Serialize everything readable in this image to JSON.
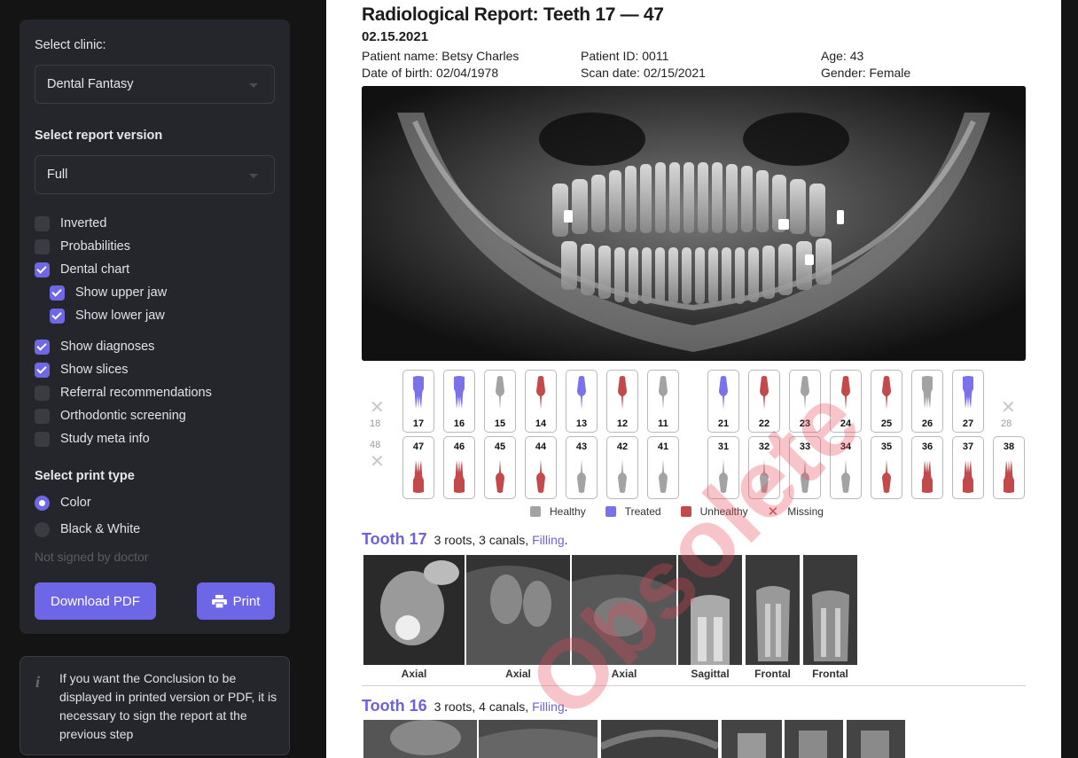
{
  "sidebar": {
    "clinic_label": "Select clinic:",
    "clinic_value": "Dental Fantasy",
    "version_label": "Select report version",
    "version_value": "Full",
    "options": [
      {
        "label": "Inverted",
        "checked": false
      },
      {
        "label": "Probabilities",
        "checked": false
      },
      {
        "label": "Dental chart",
        "checked": true
      },
      {
        "label": "Show upper jaw",
        "checked": true
      },
      {
        "label": "Show lower jaw",
        "checked": true
      },
      {
        "label": "Show diagnoses",
        "checked": true
      },
      {
        "label": "Show slices",
        "checked": true
      },
      {
        "label": "Referral recommendations",
        "checked": false
      },
      {
        "label": "Orthodontic screening",
        "checked": false
      },
      {
        "label": "Study meta info",
        "checked": false
      }
    ],
    "print_type_label": "Select print type",
    "print_types": [
      {
        "label": "Color",
        "selected": true
      },
      {
        "label": "Black & White",
        "selected": false
      }
    ],
    "signed_status": "Not signed by doctor",
    "download_label": "Download PDF",
    "print_label": "Print",
    "info_text": "If you want the Conclusion to be displayed in printed version or PDF, it is necessary to sign the report at the previous step"
  },
  "report": {
    "title": "Radiological Report: Teeth 17 — 47",
    "date": "02.15.2021",
    "patient_name": "Patient name: Betsy Charles",
    "patient_id": "Patient ID: 0011",
    "age": "Age: 43",
    "dob": "Date of birth: 02/04/1978",
    "scan_date": "Scan date: 02/15/2021",
    "gender": "Gender: Female",
    "watermark": "Obsolete",
    "upper_teeth": [
      {
        "num": "18",
        "status": "missing"
      },
      {
        "num": "17",
        "status": "treated"
      },
      {
        "num": "16",
        "status": "treated"
      },
      {
        "num": "15",
        "status": "healthy"
      },
      {
        "num": "14",
        "status": "unhealthy"
      },
      {
        "num": "13",
        "status": "treated"
      },
      {
        "num": "12",
        "status": "unhealthy"
      },
      {
        "num": "11",
        "status": "healthy"
      },
      {
        "num": "21",
        "status": "treated"
      },
      {
        "num": "22",
        "status": "unhealthy"
      },
      {
        "num": "23",
        "status": "healthy"
      },
      {
        "num": "24",
        "status": "unhealthy"
      },
      {
        "num": "25",
        "status": "unhealthy"
      },
      {
        "num": "26",
        "status": "healthy"
      },
      {
        "num": "27",
        "status": "treated"
      },
      {
        "num": "28",
        "status": "missing"
      }
    ],
    "lower_teeth": [
      {
        "num": "48",
        "status": "missing"
      },
      {
        "num": "47",
        "status": "unhealthy"
      },
      {
        "num": "46",
        "status": "unhealthy"
      },
      {
        "num": "45",
        "status": "unhealthy"
      },
      {
        "num": "44",
        "status": "unhealthy"
      },
      {
        "num": "43",
        "status": "healthy"
      },
      {
        "num": "42",
        "status": "healthy"
      },
      {
        "num": "41",
        "status": "healthy"
      },
      {
        "num": "31",
        "status": "healthy"
      },
      {
        "num": "32",
        "status": "healthy"
      },
      {
        "num": "33",
        "status": "healthy"
      },
      {
        "num": "34",
        "status": "healthy"
      },
      {
        "num": "35",
        "status": "unhealthy"
      },
      {
        "num": "36",
        "status": "unhealthy"
      },
      {
        "num": "37",
        "status": "unhealthy"
      },
      {
        "num": "38",
        "status": "unhealthy"
      }
    ],
    "legend": [
      {
        "label": "Healthy",
        "color": "#a3a3a3"
      },
      {
        "label": "Treated",
        "color": "#7b72e9"
      },
      {
        "label": "Unhealthy",
        "color": "#c24a4a"
      },
      {
        "label": "Missing",
        "color": "#c24a4a"
      }
    ],
    "tooth17": {
      "name": "Tooth 17",
      "desc": "3 roots, 3 canals,",
      "link": "Filling",
      "slices": [
        "Axial",
        "Axial",
        "Axial",
        "Sagittal",
        "Frontal",
        "Frontal"
      ]
    },
    "tooth16": {
      "name": "Tooth 16",
      "desc": "3 roots, 4 canals,",
      "link": "Filling"
    },
    "colors": {
      "accent": "#6d66e6",
      "healthy": "#a3a3a3",
      "treated": "#7b72e9",
      "unhealthy": "#c24a4a"
    }
  }
}
